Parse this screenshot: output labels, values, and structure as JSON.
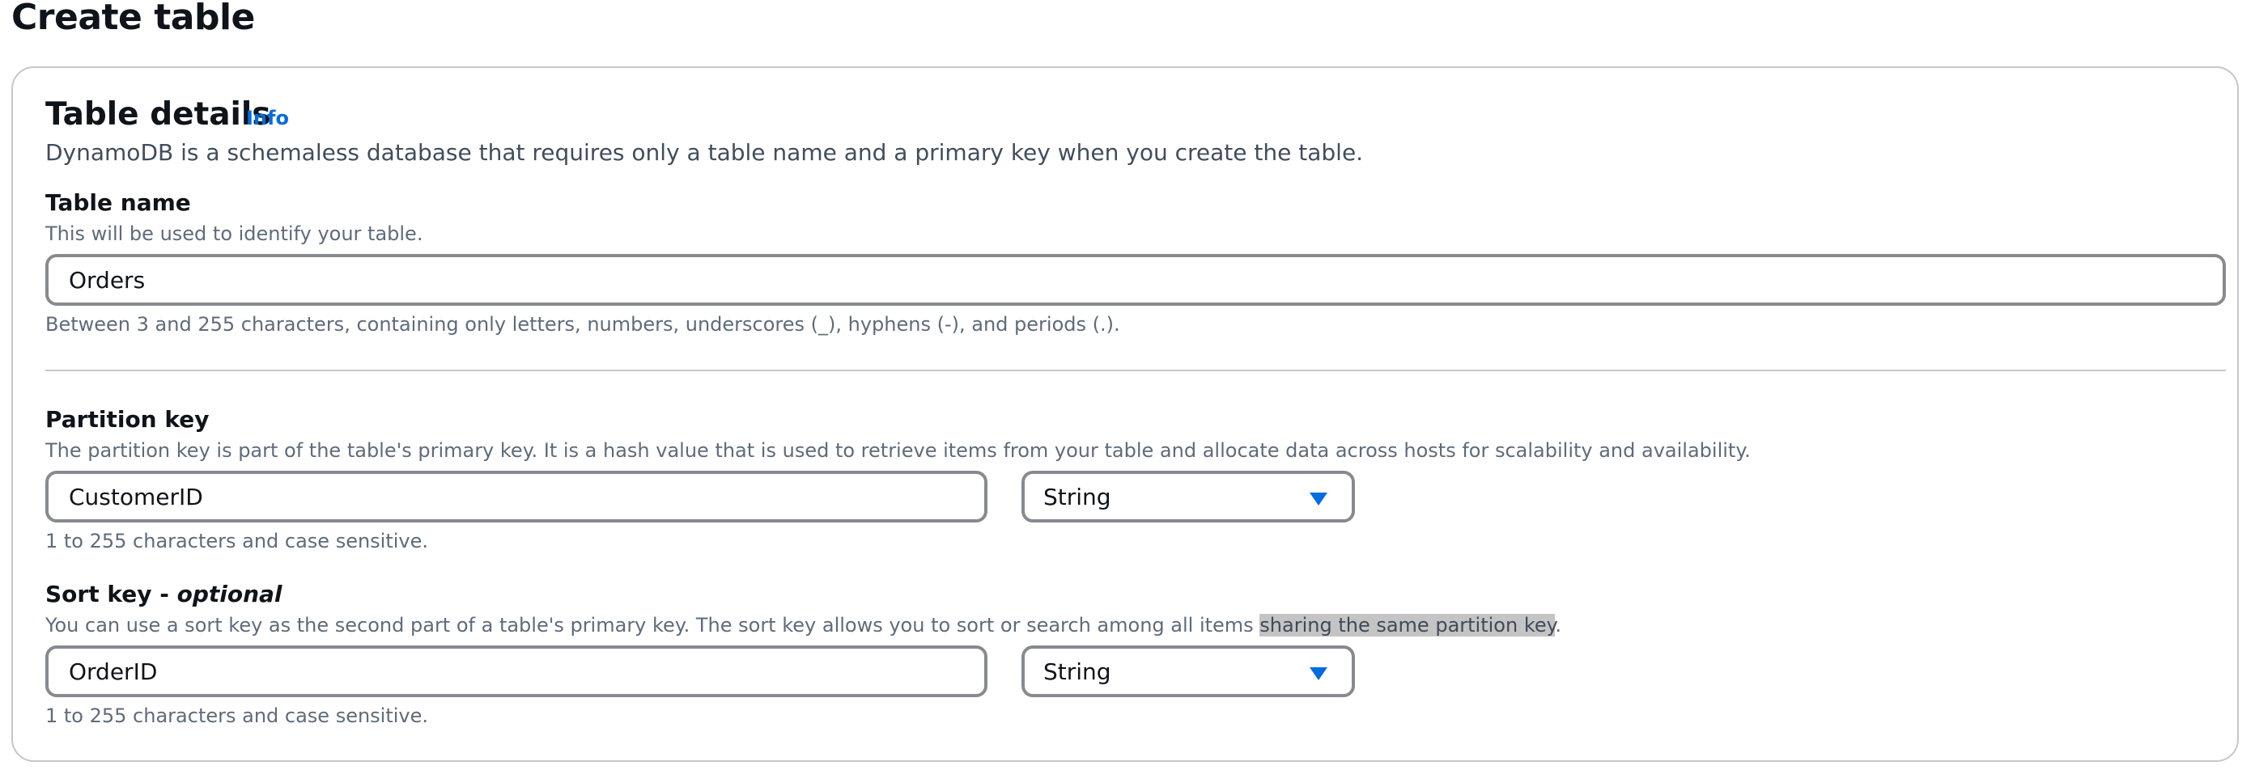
{
  "page": {
    "title": "Create table"
  },
  "table_details": {
    "title": "Table details",
    "info_link": "Info",
    "description": "DynamoDB is a schemaless database that requires only a table name and a primary key when you create the table."
  },
  "table_name": {
    "label": "Table name",
    "description": "This will be used to identify your table.",
    "value": "Orders",
    "constraint": "Between 3 and 255 characters, containing only letters, numbers, underscores (_), hyphens (-), and periods (.)."
  },
  "partition_key": {
    "label": "Partition key",
    "description": "The partition key is part of the table's primary key. It is a hash value that is used to retrieve items from your table and allocate data across hosts for scalability and availability.",
    "value": "CustomerID",
    "type": "String",
    "constraint": "1 to 255 characters and case sensitive."
  },
  "sort_key": {
    "label": "Sort key - ",
    "label_optional": "optional",
    "description_start": "You can use a sort key as the second part of a table's primary key. The sort key allows you to sort or search among all items ",
    "description_highlight": "sharing the same partition key",
    "description_end": ".",
    "value": "OrderID",
    "type": "String",
    "constraint": "1 to 255 characters and case sensitive."
  },
  "colors": {
    "link": "#006ce0",
    "border": "#878a8f",
    "panel_border": "#c6c6cd",
    "highlight": "#c4c4c4"
  }
}
